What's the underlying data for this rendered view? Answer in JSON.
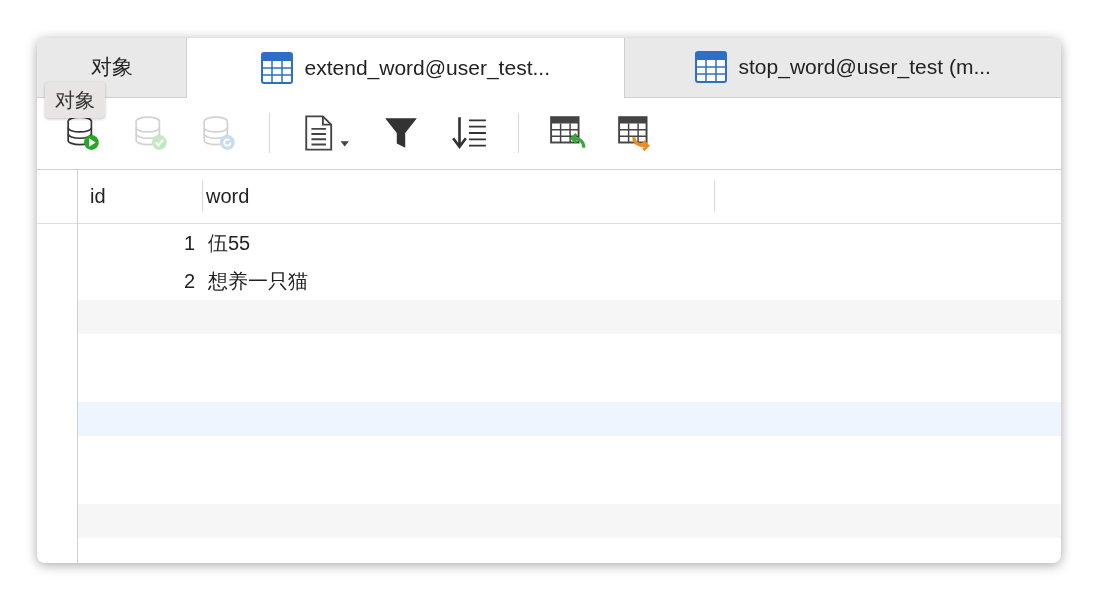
{
  "tabs": [
    {
      "label": "对象",
      "kind": "plain",
      "selected": false
    },
    {
      "label": "extend_word@user_test...",
      "kind": "table",
      "selected": true
    },
    {
      "label": "stop_word@user_test (m...",
      "kind": "table",
      "selected": false
    }
  ],
  "tooltip": {
    "text": "对象"
  },
  "toolbar": [
    {
      "kind": "db-run",
      "disabled": false
    },
    {
      "kind": "db-check",
      "disabled": true
    },
    {
      "kind": "db-refresh",
      "disabled": true
    },
    {
      "kind": "separator"
    },
    {
      "kind": "document",
      "disabled": false
    },
    {
      "kind": "filter",
      "disabled": false
    },
    {
      "kind": "sort",
      "disabled": false
    },
    {
      "kind": "separator"
    },
    {
      "kind": "import",
      "disabled": false
    },
    {
      "kind": "export",
      "disabled": false
    }
  ],
  "table": {
    "columns": [
      "id",
      "word"
    ],
    "rows": [
      [
        "1",
        "伍55"
      ],
      [
        "2",
        "想养一只猫"
      ]
    ]
  }
}
